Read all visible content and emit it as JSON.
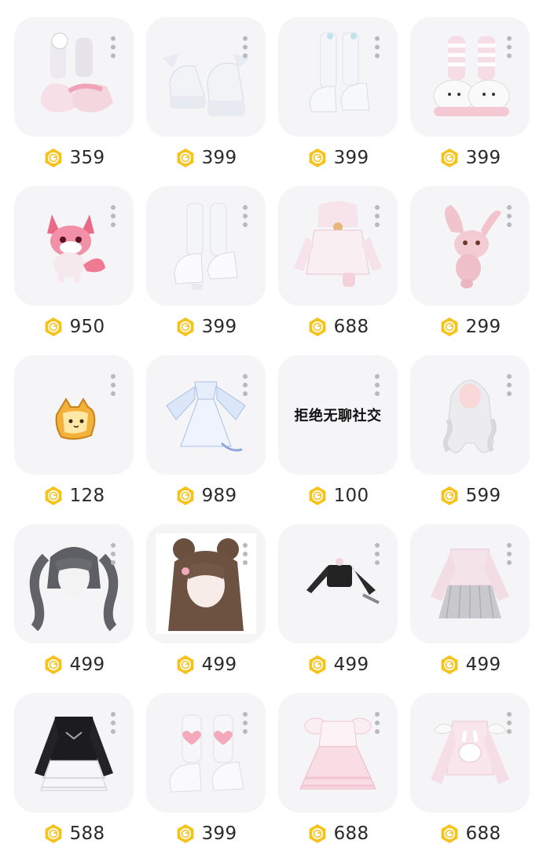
{
  "theme": {
    "card_bg": "#f5f4f6",
    "coin_gold": "#f6c21c",
    "coin_inner": "#ffffff",
    "price_text": "#2a2a2a"
  },
  "items": [
    {
      "name": "pink-slipper-boots-item",
      "icon": "pink-slipper-leg-warmer-shoes",
      "price": "359"
    },
    {
      "name": "white-winged-platform-shoes-item",
      "icon": "white-winged-platform-shoes",
      "price": "399"
    },
    {
      "name": "white-ribbon-boots-item",
      "icon": "white-ribbon-boots",
      "price": "399"
    },
    {
      "name": "kitty-slipper-socks-item",
      "icon": "kitty-slippers-striped-socks",
      "price": "399"
    },
    {
      "name": "pink-fox-pet-item",
      "icon": "pink-fox-pet",
      "price": "950"
    },
    {
      "name": "white-lace-boots-item",
      "icon": "white-lace-platform-boots",
      "price": "399"
    },
    {
      "name": "pink-bunny-dress-item",
      "icon": "pink-bunny-dress",
      "price": "688"
    },
    {
      "name": "pink-bunny-plush-item",
      "icon": "pink-bunny-plush",
      "price": "299"
    },
    {
      "name": "cat-toast-item",
      "icon": "cat-toast-accessory",
      "price": "128"
    },
    {
      "name": "blue-fairy-dress-item",
      "icon": "blue-fairy-dress",
      "price": "989"
    },
    {
      "name": "text-item",
      "icon": "text-card",
      "thumb_text": "拒绝无聊社交",
      "price": "100"
    },
    {
      "name": "long-white-curly-hair-item",
      "icon": "long-white-curly-hair",
      "price": "599"
    },
    {
      "name": "grey-twin-tails-hair-item",
      "icon": "grey-twin-tails-hair",
      "price": "499"
    },
    {
      "name": "brown-buns-hair-item",
      "icon": "brown-buns-bunny-clip-hair",
      "price": "499"
    },
    {
      "name": "black-crop-top-item",
      "icon": "black-crop-top-outfit",
      "price": "499"
    },
    {
      "name": "pink-sailor-skirt-item",
      "icon": "pink-sailor-top-grey-skirt",
      "price": "499"
    },
    {
      "name": "black-frilly-dress-item",
      "icon": "black-white-frilly-dress",
      "price": "588"
    },
    {
      "name": "heart-boots-item",
      "icon": "pink-heart-white-boots",
      "price": "399"
    },
    {
      "name": "pink-lolita-dress-item",
      "icon": "pink-lolita-dress",
      "price": "688"
    },
    {
      "name": "pink-bunny-sweater-item",
      "icon": "pink-bunny-wing-sweater",
      "price": "688"
    }
  ]
}
